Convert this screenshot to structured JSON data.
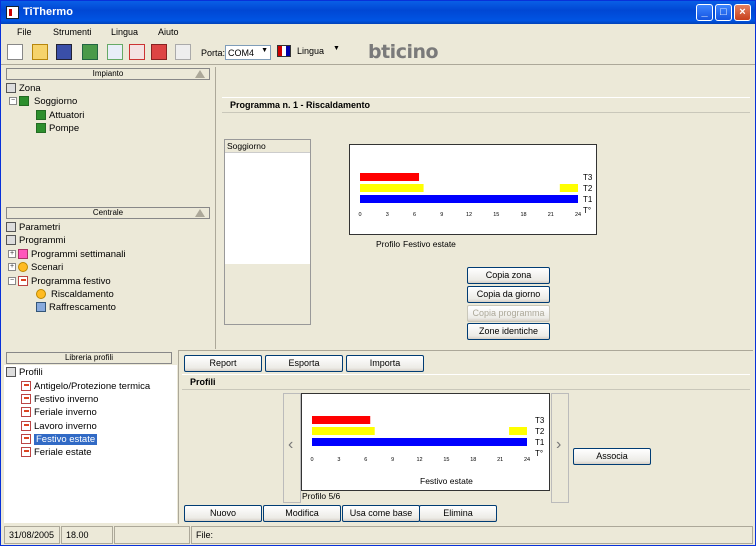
{
  "window": {
    "title": "TiThermo"
  },
  "menu": [
    "File",
    "Strumenti",
    "Lingua",
    "Aiuto"
  ],
  "toolbar": {
    "port_label": "Porta:",
    "port_value": "COM4",
    "lang_label": "Lingua",
    "brand": "bticino"
  },
  "impianto": {
    "header": "Impianto",
    "root": "Zona",
    "zone": "Soggiorno",
    "children": [
      "Attuatori",
      "Pompe"
    ]
  },
  "centrale": {
    "header": "Centrale",
    "items": [
      "Parametri",
      "Programmi",
      "Programmi settimanali",
      "Scenari",
      "Programma festivo",
      "Riscaldamento",
      "Raffrescamento"
    ]
  },
  "program": {
    "title": "Programma n. 1 - Riscaldamento",
    "zone_list_header": "Soggiorno",
    "profile_label": "Profilo",
    "profile_name": "Festivo estate"
  },
  "actions": {
    "copy_zone": "Copia zona",
    "copy_day": "Copia da giorno",
    "copy_program": "Copia programma",
    "identical_zones": "Zone identiche"
  },
  "libreria": {
    "header": "Libreria profili",
    "root": "Profili",
    "items": [
      "Antigelo/Protezione termica",
      "Festivo inverno",
      "Feriale inverno",
      "Lavoro inverno",
      "Festivo estate",
      "Feriale estate"
    ]
  },
  "lower": {
    "report": "Report",
    "export": "Esporta",
    "import": "Importa",
    "section": "Profili",
    "profile_caption": "Festivo estate",
    "profile_counter": "Profilo 5/6",
    "associate": "Associa",
    "new": "Nuovo",
    "modify": "Modifica",
    "use_as_base": "Usa come base",
    "delete": "Elimina"
  },
  "status": {
    "date": "31/08/2005",
    "time": "18.00",
    "file_label": "File:"
  },
  "chart_data": {
    "type": "bar",
    "x_ticks": [
      "0",
      "3",
      "6",
      "9",
      "12",
      "15",
      "18",
      "21",
      "24"
    ],
    "levels": [
      "T3",
      "T2",
      "T1",
      "T°"
    ],
    "xlim": [
      0,
      24
    ],
    "segments": [
      {
        "level": "T3",
        "start": 0,
        "end": 6.5,
        "color": "#ff0000"
      },
      {
        "level": "T2",
        "start": 0,
        "end": 7,
        "color": "#ffff00"
      },
      {
        "level": "T2",
        "start": 22,
        "end": 24,
        "color": "#ffff00"
      },
      {
        "level": "T1",
        "start": 0,
        "end": 24,
        "color": "#0000ff"
      }
    ]
  }
}
